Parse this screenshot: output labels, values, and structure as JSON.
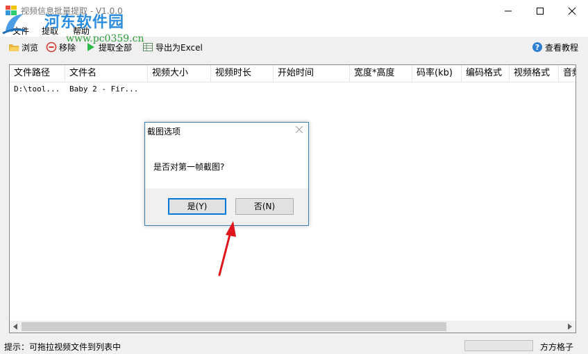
{
  "window": {
    "title": "视频信息批量提取 - V1.0.0"
  },
  "watermark": {
    "name": "河东软件园",
    "url": "www.pc0359.cn"
  },
  "menu": {
    "items": [
      "文件",
      "提取",
      "帮助"
    ]
  },
  "toolbar": {
    "browse": "浏览",
    "remove": "移除",
    "extract_all": "提取全部",
    "export_excel": "导出为Excel",
    "help": "查看教程"
  },
  "list": {
    "columns": [
      "文件路径",
      "文件名",
      "视频大小",
      "视频时长",
      "开始时间",
      "宽度*高度",
      "码率(kb)",
      "编码格式",
      "视频格式",
      "音频"
    ],
    "rows": [
      {
        "path": "D:\\tool...",
        "name": "Baby 2 - Fir..."
      }
    ]
  },
  "dialog": {
    "title": "截图选项",
    "message": "是否对第一帧截图?",
    "yes": "是(Y)",
    "no": "否(N)"
  },
  "status": {
    "hint": "提示：可拖拉视频文件到列表中",
    "user": "方方格子"
  },
  "colors": {
    "accent": "#0078d7",
    "arrow": "#e0161c"
  }
}
